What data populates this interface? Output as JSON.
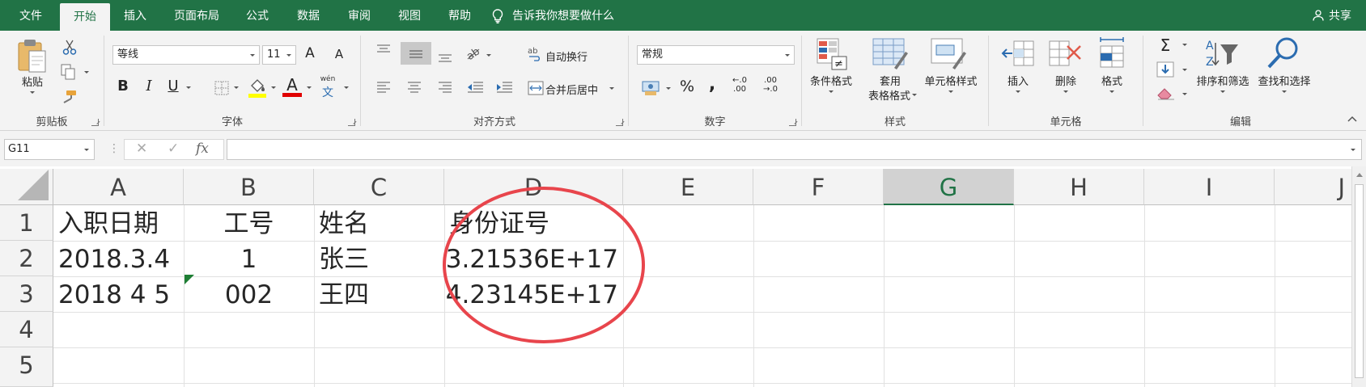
{
  "tabs": [
    "文件",
    "开始",
    "插入",
    "页面布局",
    "公式",
    "数据",
    "审阅",
    "视图",
    "帮助"
  ],
  "active_tab": "开始",
  "tell_me": "告诉我你想要做什么",
  "share": "共享",
  "ribbon": {
    "clipboard": {
      "paste": "粘贴",
      "label": "剪贴板"
    },
    "font": {
      "name": "等线",
      "size": "11",
      "grow": "A",
      "shrink": "A",
      "bold": "B",
      "italic": "I",
      "underline": "U",
      "color_letter": "A",
      "phonetic_top": "wén",
      "phonetic_bottom": "文",
      "label": "字体"
    },
    "alignment": {
      "wrap": "自动换行",
      "merge": "合并后居中",
      "label": "对齐方式"
    },
    "number": {
      "format": "常规",
      "percent": "%",
      "comma": ",",
      "inc_decimal_top": "←.0",
      "inc_decimal_bottom": ".00",
      "dec_decimal_top": ".00",
      "dec_decimal_bottom": "→.0",
      "label": "数字"
    },
    "styles": {
      "conditional": "条件格式",
      "table_line1": "套用",
      "table_line2": "表格格式",
      "cell_styles": "单元格样式",
      "label": "样式"
    },
    "cells": {
      "insert": "插入",
      "delete": "删除",
      "format": "格式",
      "label": "单元格"
    },
    "editing": {
      "sort": "排序和筛选",
      "find": "查找和选择",
      "label": "编辑"
    }
  },
  "formula_bar": {
    "name_box": "G11",
    "cancel": "✕",
    "enter": "✓",
    "fx": "fx",
    "formula": ""
  },
  "sheet": {
    "columns": [
      "A",
      "B",
      "C",
      "D",
      "E",
      "F",
      "G",
      "H",
      "I",
      "J"
    ],
    "selected_column": "G",
    "rows": [
      "1",
      "2",
      "3",
      "4",
      "5"
    ],
    "cells": {
      "A1": "入职日期",
      "B1": "工号",
      "C1": "姓名",
      "D1": "身份证号",
      "A2": "2018.3.4",
      "B2": "1",
      "C2": "张三",
      "D2": "3.21536E+17",
      "A3": "2018 4 5",
      "B3": "002",
      "C3": "王四",
      "D3": "4.23145E+17"
    }
  },
  "colors": {
    "accent": "#217346",
    "circle": "#e8454c",
    "error_indicator": "#1e7e34"
  }
}
